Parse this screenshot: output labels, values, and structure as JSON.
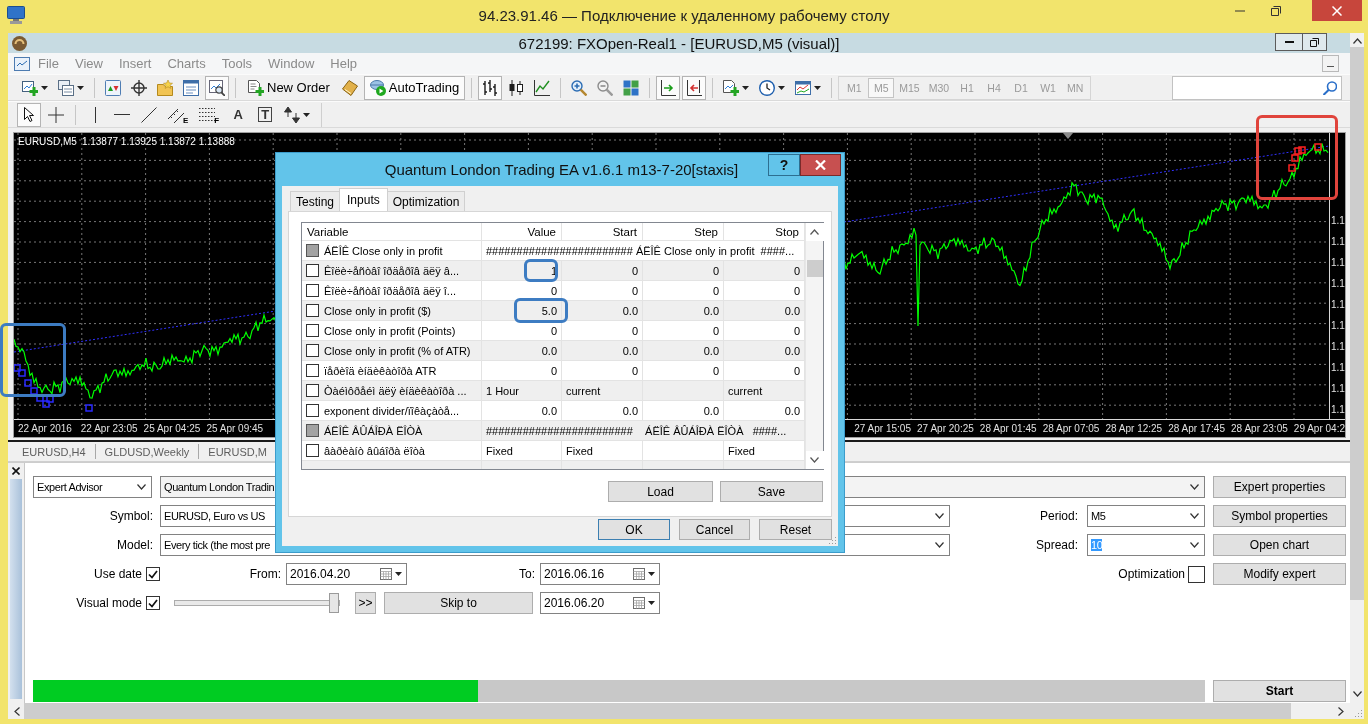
{
  "remote_window": {
    "title": "94.23.91.46 — Подключение к удаленному рабочему столу"
  },
  "app_window": {
    "title": "672199: FXOpen-Real1 - [EURUSD,M5 (visual)]"
  },
  "menu": [
    "File",
    "View",
    "Insert",
    "Charts",
    "Tools",
    "Window",
    "Help"
  ],
  "toolbar": [
    {
      "kind": "icon",
      "dropdown": true,
      "pressed": false
    },
    {
      "kind": "icon",
      "dropdown": true,
      "pressed": false
    },
    {
      "kind": "separator"
    },
    {
      "kind": "icon",
      "dropdown": false,
      "pressed": false
    },
    {
      "kind": "icon",
      "dropdown": false,
      "pressed": false
    },
    {
      "kind": "icon",
      "dropdown": false,
      "pressed": false
    },
    {
      "kind": "icon",
      "dropdown": false,
      "pressed": false
    },
    {
      "kind": "icon",
      "dropdown": false,
      "pressed": true
    },
    {
      "kind": "separator"
    },
    {
      "kind": "text",
      "label": "New Order",
      "pressed": false
    },
    {
      "kind": "icon",
      "dropdown": false,
      "pressed": false
    },
    {
      "kind": "text",
      "label": "AutoTrading",
      "pressed": true
    },
    {
      "kind": "separator"
    },
    {
      "kind": "icon",
      "dropdown": false,
      "pressed": true
    },
    {
      "kind": "icon",
      "dropdown": false,
      "pressed": false
    },
    {
      "kind": "icon",
      "dropdown": false,
      "pressed": false
    },
    {
      "kind": "separator"
    },
    {
      "kind": "icon",
      "dropdown": false,
      "pressed": false
    },
    {
      "kind": "icon",
      "dropdown": false,
      "pressed": false
    },
    {
      "kind": "icon",
      "dropdown": false,
      "pressed": false
    },
    {
      "kind": "separator"
    },
    {
      "kind": "icon",
      "dropdown": false,
      "pressed": true
    },
    {
      "kind": "icon",
      "dropdown": false,
      "pressed": true
    },
    {
      "kind": "separator"
    },
    {
      "kind": "icon",
      "dropdown": true,
      "pressed": false
    },
    {
      "kind": "icon",
      "dropdown": true,
      "pressed": false
    },
    {
      "kind": "icon",
      "dropdown": true,
      "pressed": false
    },
    {
      "kind": "separator"
    }
  ],
  "timeframes": [
    {
      "label": "M1",
      "selected": false
    },
    {
      "label": "M5",
      "selected": true
    },
    {
      "label": "M15",
      "selected": false
    },
    {
      "label": "M30",
      "selected": false
    },
    {
      "label": "H1",
      "selected": false
    },
    {
      "label": "H4",
      "selected": false
    },
    {
      "label": "D1",
      "selected": false
    },
    {
      "label": "W1",
      "selected": false
    },
    {
      "label": "MN",
      "selected": false
    }
  ],
  "drawing_toolbar": [
    {
      "kind": "icon",
      "dropdown": false,
      "pressed": true
    },
    {
      "kind": "icon",
      "dropdown": false,
      "pressed": false
    },
    {
      "kind": "separator"
    },
    {
      "kind": "icon",
      "dropdown": false,
      "pressed": false
    },
    {
      "kind": "icon",
      "dropdown": false,
      "pressed": false
    },
    {
      "kind": "icon",
      "dropdown": false,
      "pressed": false
    },
    {
      "kind": "icon",
      "dropdown": false,
      "pressed": false,
      "letter": "E"
    },
    {
      "kind": "icon",
      "dropdown": false,
      "pressed": false,
      "letter": "F"
    },
    {
      "kind": "glyph",
      "label": "A",
      "pressed": false
    },
    {
      "kind": "boxed-glyph",
      "label": "T",
      "pressed": false
    },
    {
      "kind": "icon",
      "dropdown": true,
      "pressed": false
    }
  ],
  "chart": {
    "symbol": "EURUSD,M5",
    "ohlc": "1.13877 1.13925 1.13872 1.13888",
    "price_labels": [
      "1.1",
      "1.1",
      "1.1",
      "1.1",
      "1.1",
      "1.1",
      "1.1",
      "1.1",
      "1.1",
      "1.1"
    ],
    "time_label_groups": [
      [
        "22 Apr 2016",
        "22 Apr 23:05",
        "25 Apr 04:25",
        "25 Apr 09:45"
      ],
      [
        "27 Apr 15:05",
        "27 Apr 20:25",
        "28 Apr 01:45",
        "28 Apr 07:05",
        "28 Apr 12:25",
        "28 Apr 17:45",
        "28 Apr 23:05",
        "29 Apr 04:2"
      ]
    ]
  },
  "chart_tabs": [
    "EURUSD,H4",
    "GLDUSD,Weekly",
    "EURUSD,M"
  ],
  "tester": {
    "expert_kind": "Expert Advisor",
    "expert": "Quantum London Tradin",
    "symbol": {
      "label": "Symbol:",
      "value": "EURUSD, Euro vs US"
    },
    "model": {
      "label": "Model:",
      "value": "Every tick (the most pre"
    },
    "period": {
      "label": "Period:",
      "value": "M5"
    },
    "spread": {
      "label": "Spread:",
      "value": "10",
      "value_selected": true
    },
    "use_date": {
      "label": "Use date",
      "checked": true
    },
    "from": {
      "label": "From:",
      "value": "2016.04.20"
    },
    "to": {
      "label": "To:",
      "value": "2016.06.16"
    },
    "optimization": {
      "label": "Optimization",
      "checked": false
    },
    "visual_mode": {
      "label": "Visual mode",
      "checked": true
    },
    "speed": {
      "level": 1
    },
    "skip_button": ">>",
    "skip_to_button": "Skip to",
    "skip_to_date": "2016.06.20",
    "progress": {
      "level": 0.38
    },
    "side_buttons": [
      "Expert properties",
      "Symbol properties",
      "Open chart",
      "Modify expert"
    ],
    "start_button": "Start"
  },
  "dialog": {
    "title": "Quantum London Trading EA v1.6.1 m13-7-20[staxis]",
    "help_button": "?",
    "tabs": [
      {
        "label": "Testing",
        "selected": false
      },
      {
        "label": "Inputs",
        "selected": true
      },
      {
        "label": "Optimization",
        "selected": false
      }
    ],
    "columns": [
      "Variable",
      "Value",
      "Start",
      "Step",
      "Stop"
    ],
    "rows": [
      {
        "kind": "group",
        "checked": false,
        "variable": "ÁËÎÊ Close only in profit",
        "value": "######################## ÁËÎÊ Close only in profit  ####..."
      },
      {
        "kind": "number",
        "checked": false,
        "variable": "Êîëè÷åñòâî îðäåðîâ äëÿ â...",
        "value": "1",
        "start": "0",
        "step": "0",
        "stop": "0"
      },
      {
        "kind": "number",
        "checked": false,
        "variable": "Êîëè÷åñòâî îðäåðîâ äëÿ î...",
        "value": "0",
        "start": "0",
        "step": "0",
        "stop": "0"
      },
      {
        "kind": "number",
        "checked": false,
        "variable": "Close only in profit ($)",
        "value": "5.0",
        "start": "0.0",
        "step": "0.0",
        "stop": "0.0"
      },
      {
        "kind": "number",
        "checked": false,
        "variable": "Close only in profit (Points)",
        "value": "0",
        "start": "0",
        "step": "0",
        "stop": "0"
      },
      {
        "kind": "number",
        "checked": false,
        "variable": "Close only in profit (% of ATR)",
        "value": "0.0",
        "start": "0.0",
        "step": "0.0",
        "stop": "0.0"
      },
      {
        "kind": "number",
        "checked": false,
        "variable": "ïåðèîä èíäèêàòîðà ATR",
        "value": "0",
        "start": "0",
        "step": "0",
        "stop": "0"
      },
      {
        "kind": "choice",
        "checked": false,
        "variable": "Òàéìôðåéì äëÿ èíäèêàòîðà ...",
        "value": "1 Hour",
        "start": "current",
        "stop": "current"
      },
      {
        "kind": "number",
        "checked": false,
        "variable": "exponent divider/ïîêàçàòå...",
        "value": "0.0",
        "start": "0.0",
        "step": "0.0",
        "stop": "0.0"
      },
      {
        "kind": "group",
        "checked": false,
        "variable": "ÁËÎÊ ÂÛÁÎÐÀ ËÎÒÀ",
        "value": "########################    ÁËÎÊ ÂÛÁÎÐÀ ËÎÒÀ   ####..."
      },
      {
        "kind": "choice",
        "checked": false,
        "variable": "âàðèàíò âûáîðà ëîòà",
        "value": "Fixed",
        "start": "Fixed",
        "stop": "Fixed"
      },
      {
        "kind": "number"
      }
    ],
    "load_button": "Load",
    "save_button": "Save",
    "ok_button": "OK",
    "cancel_button": "Cancel",
    "reset_button": "Reset"
  }
}
